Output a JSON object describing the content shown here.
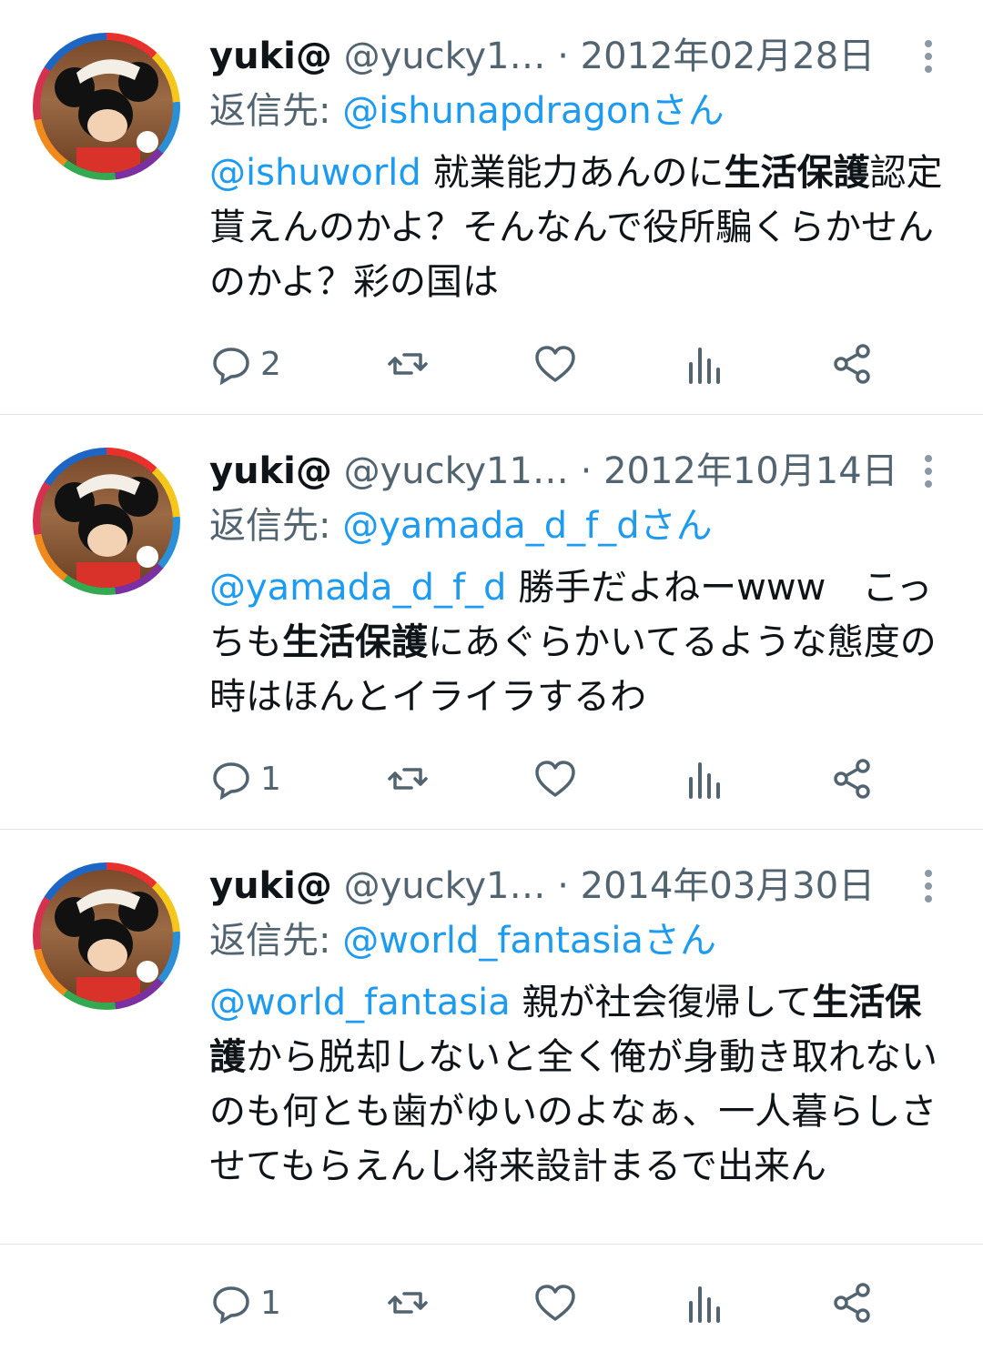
{
  "tweets": [
    {
      "name": "yuki@",
      "handle": "@yucky1…",
      "date": "· 2012年02月28日",
      "reply_label": "返信先: ",
      "reply_to": "@ishunapdragonさん",
      "body": {
        "mention": "@ishuworld",
        "pre": " 就業能力あんのに",
        "highlight": "生活保護",
        "post": "認定貰えんのかよ？そんなんで役所騙くらかせんのかよ？彩の国は"
      },
      "reply_count": "2"
    },
    {
      "name": "yuki@",
      "handle": "@yucky11…",
      "date": "· 2012年10月14日",
      "reply_label": "返信先: ",
      "reply_to": "@yamada_d_f_dさん",
      "body": {
        "mention": "@yamada_d_f_d",
        "pre": " 勝手だよねーwww　こっちも",
        "highlight": "生活保護",
        "post": "にあぐらかいてるような態度の時はほんとイライラするわ"
      },
      "reply_count": "1"
    },
    {
      "name": "yuki@",
      "handle": "@yucky1…",
      "date": "· 2014年03月30日",
      "reply_label": "返信先: ",
      "reply_to": "@world_fantasiaさん",
      "body": {
        "mention": "@world_fantasia",
        "pre": " 親が社会復帰して",
        "highlight": "生活保護",
        "post": "から脱却しないと全く俺が身動き取れないのも何とも歯がゆいのよなぁ、一人暮らしさせてもらえんし将来設計まるで出来ん"
      },
      "reply_count": "1"
    }
  ],
  "icons": [
    "more-vertical-icon",
    "reply-icon",
    "retweet-icon",
    "like-icon",
    "analytics-icon",
    "share-icon"
  ],
  "colors": {
    "link": "#1d9bf0",
    "secondary": "#536471",
    "text": "#0f1419"
  }
}
